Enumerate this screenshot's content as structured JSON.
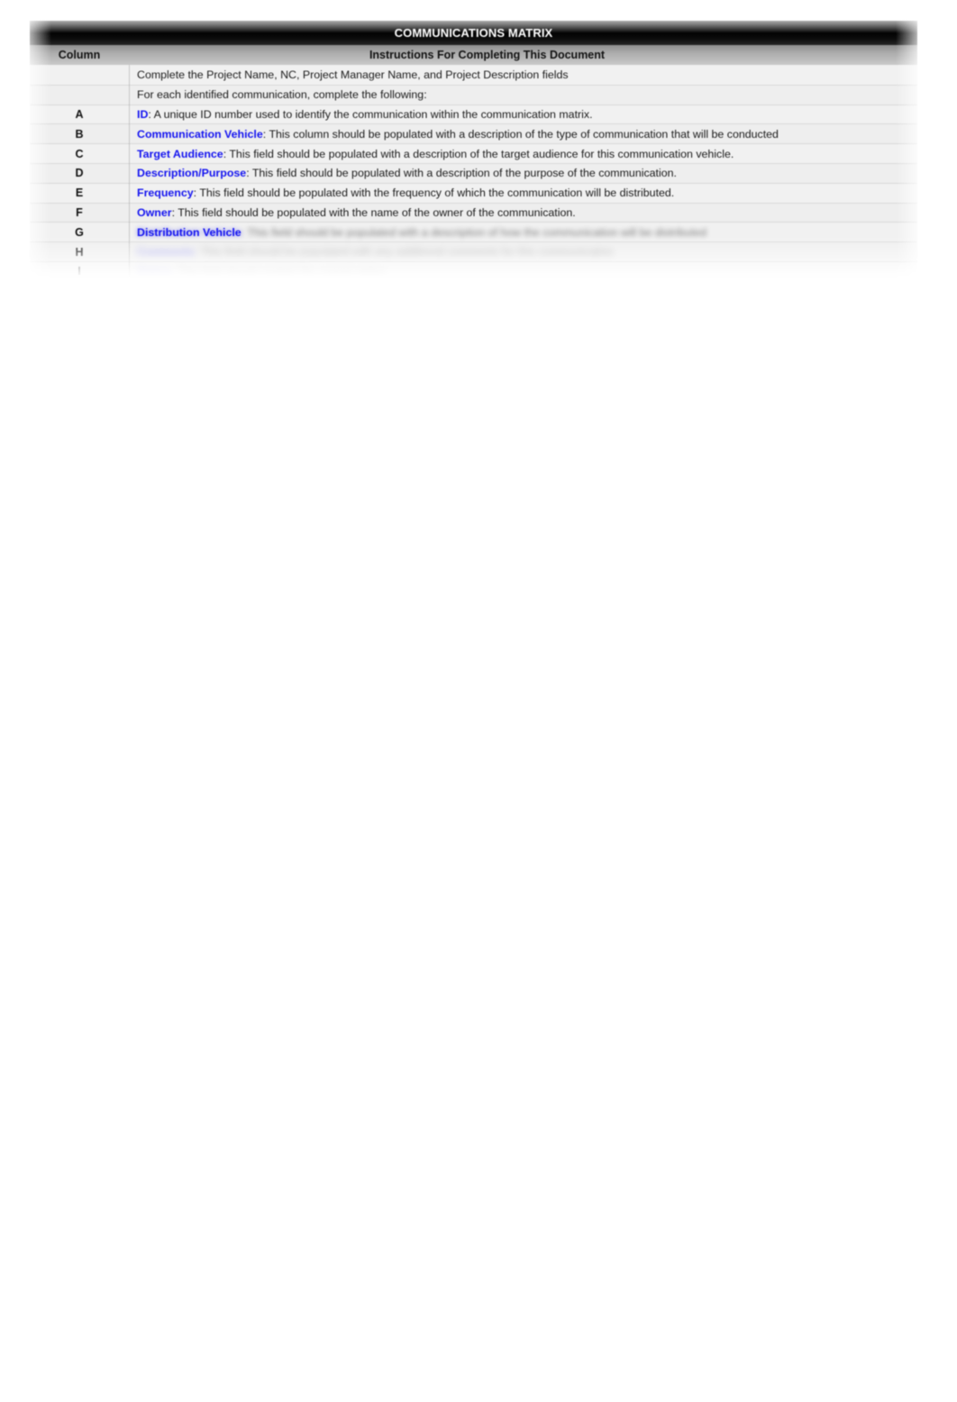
{
  "document": {
    "title": "COMMUNICATIONS MATRIX",
    "header": {
      "column_label": "Column",
      "instructions_label": "Instructions For Completing This Document"
    },
    "intro_rows": [
      {
        "column": "",
        "text": "Complete the Project Name, NC, Project Manager Name, and Project Description fields"
      },
      {
        "column": "",
        "text": "For each identified communication, complete the following:"
      }
    ],
    "rows": [
      {
        "column": "A",
        "label": "ID",
        "text": ": A unique ID number used to identify the communication within the communication matrix.",
        "legible": true
      },
      {
        "column": "B",
        "label": "Communication Vehicle",
        "text": ": This column should be populated with a description of the type of communication that will be conducted",
        "legible": true
      },
      {
        "column": "C",
        "label": "Target Audience",
        "text": ": This field should be populated with a description of the target audience for this communication vehicle.",
        "legible": true
      },
      {
        "column": "D",
        "label": "Description/Purpose",
        "text": ": This field should be populated with a description of the purpose of the communication.",
        "legible": true
      },
      {
        "column": "E",
        "label": "Frequency",
        "text": ": This field should be populated with the frequency of which the communication will be distributed.",
        "legible": true
      },
      {
        "column": "F",
        "label": "Owner",
        "text": ": This field should be populated with the name of the owner of the communication.",
        "legible": true
      },
      {
        "column": "G",
        "label": "Distribution Vehicle",
        "text": ": This field should be populated with a description of how the communication will be distributed",
        "legible": false
      },
      {
        "column": "H",
        "label": "Comments",
        "text": ": This field should be populated with any additional comments for this communication",
        "legible": false
      },
      {
        "column": "I",
        "label": "Status",
        "text": ": This field should contain the current status",
        "legible": false
      }
    ]
  },
  "colors": {
    "title_bar_background": "#000000",
    "title_bar_text": "#ffffff",
    "sub_header_background": "#bdbdbd",
    "sub_header_text": "#111111",
    "body_background": "#f0f0f0",
    "label_accent": "#1414f0",
    "body_text": "#1a1a1a",
    "page_background": "#ffffff"
  }
}
